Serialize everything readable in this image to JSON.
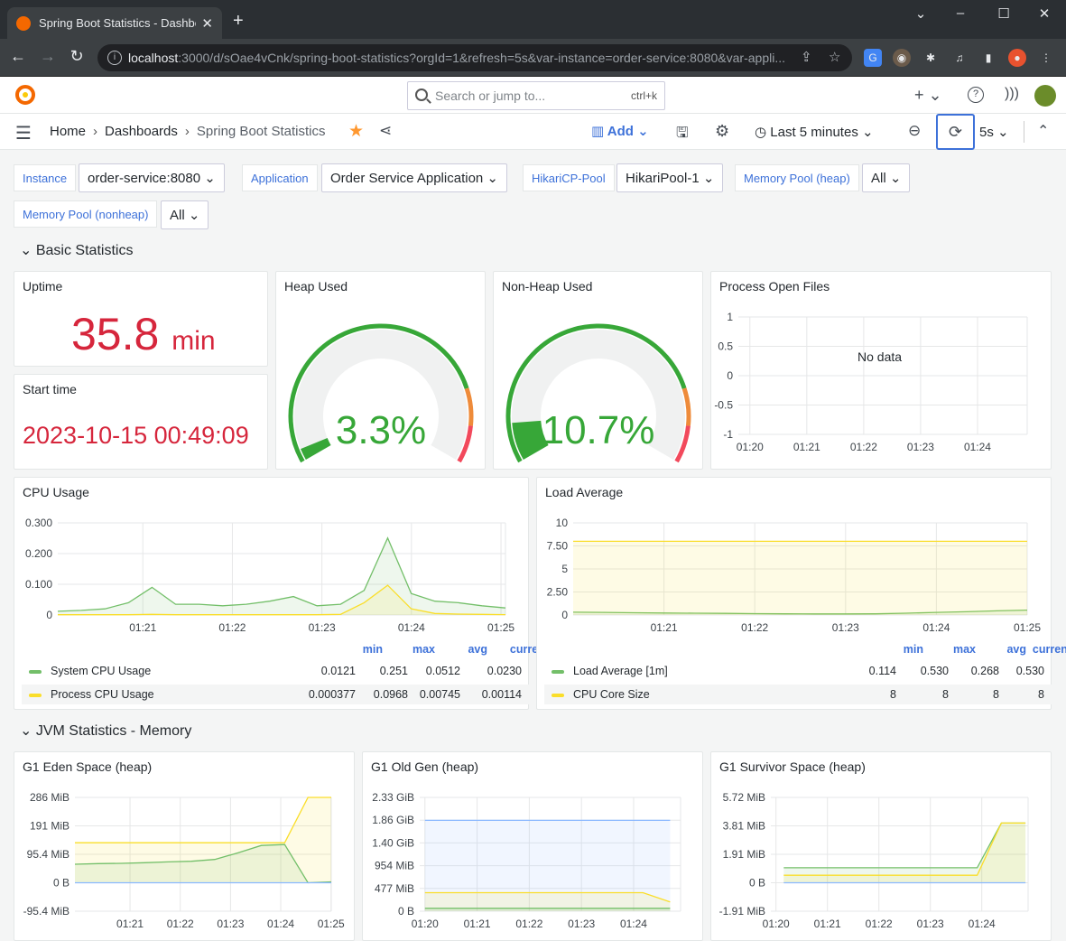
{
  "browser": {
    "tab_title": "Spring Boot Statistics - Dashboar",
    "url_host": "localhost",
    "url_rest": ":3000/d/sOae4vCnk/spring-boot-statistics?orgId=1&refresh=5s&var-instance=order-service:8080&var-appli..."
  },
  "topbar": {
    "search_placeholder": "Search or jump to...",
    "search_kbd": "ctrl+k"
  },
  "breadcrumb": {
    "home": "Home",
    "dashboards": "Dashboards",
    "current": "Spring Boot Statistics"
  },
  "toolbar": {
    "add_label": "Add",
    "time_range": "Last 5 minutes",
    "refresh_interval": "5s"
  },
  "variables": {
    "instance_label": "Instance",
    "instance_value": "order-service:8080",
    "application_label": "Application",
    "application_value": "Order Service Application",
    "hikari_label": "HikariCP-Pool",
    "hikari_value": "HikariPool-1",
    "mem_heap_label": "Memory Pool (heap)",
    "mem_heap_value": "All",
    "mem_nonheap_label": "Memory Pool (nonheap)",
    "mem_nonheap_value": "All"
  },
  "rows": {
    "basic": "Basic Statistics",
    "jvm": "JVM Statistics - Memory"
  },
  "panels": {
    "uptime": {
      "title": "Uptime",
      "value": "35.8",
      "unit": "min"
    },
    "start_time": {
      "title": "Start time",
      "value": "2023-10-15 00:49:09"
    },
    "heap_used": {
      "title": "Heap Used",
      "value": "3.3%",
      "fraction": 0.033
    },
    "nonheap_used": {
      "title": "Non-Heap Used",
      "value": "10.7%",
      "fraction": 0.107
    },
    "open_files": {
      "title": "Process Open Files",
      "no_data": "No data"
    },
    "cpu": {
      "title": "CPU Usage"
    },
    "load": {
      "title": "Load Average"
    },
    "eden": {
      "title": "G1 Eden Space (heap)"
    },
    "oldgen": {
      "title": "G1 Old Gen (heap)"
    },
    "survivor": {
      "title": "G1 Survivor Space (heap)"
    }
  },
  "legend_headers": {
    "min": "min",
    "max": "max",
    "avg": "avg",
    "current": "current"
  },
  "cpu_legend": [
    {
      "name": "System CPU Usage",
      "min": "0.0121",
      "max": "0.251",
      "avg": "0.0512",
      "current": "0.0230",
      "color": "#73bf69"
    },
    {
      "name": "Process CPU Usage",
      "min": "0.000377",
      "max": "0.0968",
      "avg": "0.00745",
      "current": "0.00114",
      "color": "#fade2a"
    }
  ],
  "load_legend": [
    {
      "name": "Load Average [1m]",
      "min": "0.114",
      "max": "0.530",
      "avg": "0.268",
      "current": "0.530",
      "color": "#73bf69"
    },
    {
      "name": "CPU Core Size",
      "min": "8",
      "max": "8",
      "avg": "8",
      "current": "8",
      "color": "#fade2a"
    }
  ],
  "chart_data": [
    {
      "type": "line",
      "title": "Process Open Files",
      "x": [
        "01:20",
        "01:21",
        "01:22",
        "01:23",
        "01:24"
      ],
      "yticks": [
        "1",
        "0.5",
        "0",
        "-0.5",
        "-1"
      ],
      "series": []
    },
    {
      "type": "line",
      "title": "CPU Usage",
      "x": [
        "01:21",
        "01:22",
        "01:23",
        "01:24",
        "01:25"
      ],
      "yticks": [
        "0.300",
        "0.200",
        "0.100",
        "0"
      ],
      "ylim": [
        0,
        0.3
      ],
      "series": [
        {
          "name": "System CPU Usage",
          "values": [
            0.012,
            0.015,
            0.02,
            0.04,
            0.09,
            0.035,
            0.035,
            0.03,
            0.035,
            0.045,
            0.06,
            0.03,
            0.035,
            0.08,
            0.251,
            0.07,
            0.045,
            0.04,
            0.03,
            0.023
          ]
        },
        {
          "name": "Process CPU Usage",
          "values": [
            0.001,
            0.001,
            0.001,
            0.001,
            0.002,
            0.001,
            0.001,
            0.001,
            0.001,
            0.001,
            0.001,
            0.001,
            0.002,
            0.04,
            0.0968,
            0.02,
            0.005,
            0.003,
            0.002,
            0.00114
          ]
        }
      ]
    },
    {
      "type": "line",
      "title": "Load Average",
      "x": [
        "01:21",
        "01:22",
        "01:23",
        "01:24",
        "01:25"
      ],
      "yticks": [
        "10",
        "7.50",
        "5",
        "2.50",
        "0"
      ],
      "ylim": [
        0,
        10
      ],
      "series": [
        {
          "name": "Load Average [1m]",
          "values": [
            0.3,
            0.28,
            0.25,
            0.22,
            0.2,
            0.18,
            0.15,
            0.13,
            0.12,
            0.114,
            0.13,
            0.2,
            0.28,
            0.35,
            0.45,
            0.53
          ]
        },
        {
          "name": "CPU Core Size",
          "values": [
            8,
            8,
            8,
            8,
            8,
            8,
            8,
            8,
            8,
            8,
            8,
            8,
            8,
            8,
            8,
            8
          ]
        }
      ]
    },
    {
      "type": "line",
      "title": "G1 Eden Space (heap)",
      "x": [
        "01:21",
        "01:22",
        "01:23",
        "01:24",
        "01:25"
      ],
      "yticks": [
        "286 MiB",
        "191 MiB",
        "95.4 MiB",
        "0 B",
        "-95.4 MiB"
      ],
      "ylim": [
        -95.4,
        286
      ],
      "series": [
        {
          "values": [
            134,
            134,
            134,
            134,
            134,
            134,
            134,
            134,
            134,
            134,
            286,
            286
          ]
        },
        {
          "values": [
            62,
            64,
            65,
            67,
            70,
            72,
            78,
            100,
            125,
            128,
            0,
            3
          ]
        },
        {
          "values": [
            0,
            0,
            0,
            0,
            0,
            0,
            0,
            0,
            0,
            0,
            0,
            0
          ]
        }
      ]
    },
    {
      "type": "line",
      "title": "G1 Old Gen (heap)",
      "x": [
        "01:20",
        "01:21",
        "01:22",
        "01:23",
        "01:24"
      ],
      "yticks": [
        "2.33 GiB",
        "1.86 GiB",
        "1.40 GiB",
        "954 MiB",
        "477 MiB",
        "0 B"
      ],
      "ylim": [
        0,
        2.33
      ],
      "series": [
        {
          "values": [
            1.86,
            1.86,
            1.86,
            1.86,
            1.86,
            1.86,
            1.86,
            1.86,
            1.86,
            1.86
          ]
        },
        {
          "values": [
            0.38,
            0.38,
            0.38,
            0.38,
            0.38,
            0.38,
            0.38,
            0.38,
            0.38,
            0.19
          ]
        },
        {
          "values": [
            0.06,
            0.06,
            0.06,
            0.06,
            0.06,
            0.06,
            0.06,
            0.06,
            0.06,
            0.06
          ]
        }
      ]
    },
    {
      "type": "line",
      "title": "G1 Survivor Space (heap)",
      "x": [
        "01:20",
        "01:21",
        "01:22",
        "01:23",
        "01:24"
      ],
      "yticks": [
        "5.72 MiB",
        "3.81 MiB",
        "1.91 MiB",
        "0 B",
        "-1.91 MiB"
      ],
      "ylim": [
        -1.91,
        5.72
      ],
      "series": [
        {
          "values": [
            1,
            1,
            1,
            1,
            1,
            1,
            1,
            1,
            1,
            4,
            4
          ]
        },
        {
          "values": [
            0.5,
            0.5,
            0.5,
            0.5,
            0.5,
            0.5,
            0.5,
            0.5,
            0.5,
            4,
            4
          ]
        },
        {
          "values": [
            0,
            0,
            0,
            0,
            0,
            0,
            0,
            0,
            0,
            0,
            0
          ]
        }
      ]
    }
  ],
  "colors": {
    "green": "#73bf69",
    "yellow": "#fade2a",
    "blue": "#8ab8ff",
    "red": "#d6263c",
    "gauge_green": "#37a738",
    "orange": "#ee8b3a",
    "accent": "#3d71d9"
  }
}
